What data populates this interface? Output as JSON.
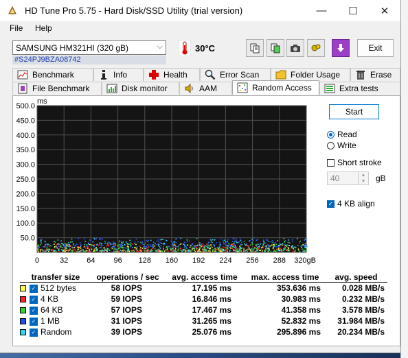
{
  "window": {
    "title": "HD Tune Pro 5.75 - Hard Disk/SSD Utility (trial version)",
    "minimize": "—",
    "maximize": "☐",
    "close": "✕"
  },
  "menu": {
    "file": "File",
    "help": "Help"
  },
  "toolbar": {
    "drive": "SAMSUNG HM321HI (320 gB)",
    "serial": "#S24PJ9BZA08742",
    "temperature": "30°C",
    "exit": "Exit"
  },
  "tabs_row1": [
    {
      "label": "Benchmark",
      "icon": "benchmark-icon"
    },
    {
      "label": "Info",
      "icon": "info-icon"
    },
    {
      "label": "Health",
      "icon": "health-icon"
    },
    {
      "label": "Error Scan",
      "icon": "magnifier-icon"
    },
    {
      "label": "Folder Usage",
      "icon": "folder-icon"
    },
    {
      "label": "Erase",
      "icon": "trash-icon"
    }
  ],
  "tabs_row2": [
    {
      "label": "File Benchmark",
      "icon": "file-icon"
    },
    {
      "label": "Disk monitor",
      "icon": "monitor-icon"
    },
    {
      "label": "AAM",
      "icon": "speaker-icon"
    },
    {
      "label": "Random Access",
      "icon": "random-icon",
      "active": true
    },
    {
      "label": "Extra tests",
      "icon": "extra-icon"
    }
  ],
  "controls": {
    "start": "Start",
    "read": "Read",
    "write": "Write",
    "mode": "read",
    "short_stroke": "Short stroke",
    "short_stroke_checked": false,
    "stroke_value": "40",
    "stroke_unit": "gB",
    "align_4kb": "4 KB align",
    "align_4kb_checked": true
  },
  "chart_data": {
    "type": "scatter",
    "ylabel": "ms",
    "ylim": [
      0,
      500
    ],
    "yticks": [
      "500.0",
      "450.0",
      "400.0",
      "350.0",
      "300.0",
      "250.0",
      "200.0",
      "150.0",
      "100.0",
      "50.0"
    ],
    "xlim": [
      0,
      320
    ],
    "xticks": [
      "0",
      "32",
      "64",
      "96",
      "128",
      "160",
      "192",
      "224",
      "256",
      "288",
      "320gB"
    ],
    "grid": true,
    "series": [
      {
        "name": "512 bytes",
        "color": "#ffff40",
        "typical_ms": [
          5,
          30
        ]
      },
      {
        "name": "4 KB",
        "color": "#ff3030",
        "typical_ms": [
          5,
          30
        ]
      },
      {
        "name": "64 KB",
        "color": "#40d040",
        "typical_ms": [
          5,
          40
        ]
      },
      {
        "name": "1 MB",
        "color": "#3060ff",
        "typical_ms": [
          20,
          50
        ]
      },
      {
        "name": "Random",
        "color": "#40d8e8",
        "typical_ms": [
          5,
          50
        ]
      }
    ]
  },
  "results": {
    "headers": [
      "transfer size",
      "operations / sec",
      "avg. access time",
      "max. access time",
      "avg. speed"
    ],
    "rows": [
      {
        "swatch": "#ffff40",
        "size": "512 bytes",
        "ops": "58 IOPS",
        "avg": "17.195 ms",
        "max": "353.636 ms",
        "speed": "0.028 MB/s"
      },
      {
        "swatch": "#ff2020",
        "size": "4 KB",
        "ops": "59 IOPS",
        "avg": "16.846 ms",
        "max": "30.983 ms",
        "speed": "0.232 MB/s"
      },
      {
        "swatch": "#30d030",
        "size": "64 KB",
        "ops": "57 IOPS",
        "avg": "17.467 ms",
        "max": "41.358 ms",
        "speed": "3.578 MB/s"
      },
      {
        "swatch": "#2050e0",
        "size": "1 MB",
        "ops": "31 IOPS",
        "avg": "31.265 ms",
        "max": "52.832 ms",
        "speed": "31.984 MB/s"
      },
      {
        "swatch": "#30d8f0",
        "size": "Random",
        "ops": "39 IOPS",
        "avg": "25.076 ms",
        "max": "295.896 ms",
        "speed": "20.234 MB/s"
      }
    ]
  }
}
